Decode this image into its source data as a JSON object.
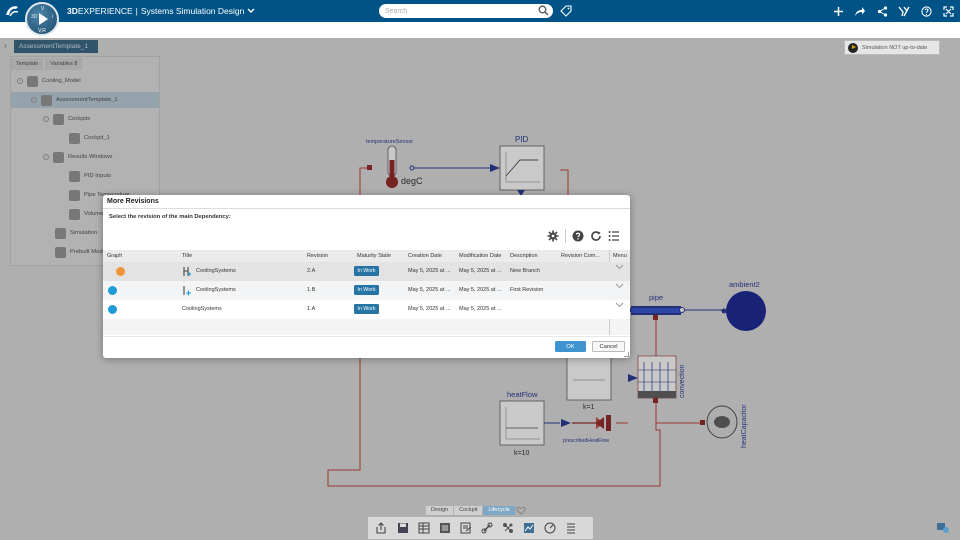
{
  "app": {
    "brand_bold": "3D",
    "brand_name": "EXPERIENCE",
    "separator": "|",
    "app_title": "Systems Simulation Design",
    "compass_version": "V,R",
    "compass_labels": [
      "3D",
      "V",
      "i"
    ],
    "search_placeholder": "Search"
  },
  "tree": {
    "tab_label": "AssessmentTemplate_1",
    "subtabs": [
      "Template",
      "Variables 8"
    ],
    "nodes": [
      {
        "label": "Cooling_Model",
        "depth": 0
      },
      {
        "label": "AssessmentTemplate_1",
        "depth": 1
      },
      {
        "label": "Cockpits",
        "depth": 2
      },
      {
        "label": "Cockpit_1",
        "depth": 3
      },
      {
        "label": "Results Windows",
        "depth": 2
      },
      {
        "label": "PID Inputs",
        "depth": 3
      },
      {
        "label": "Pipe Temperature",
        "depth": 3
      },
      {
        "label": "Volume",
        "depth": 3
      },
      {
        "label": "Simulation",
        "depth": 2
      },
      {
        "label": "Prebuilt Models",
        "depth": 2
      }
    ]
  },
  "diagram": {
    "labels": {
      "temperature_sensor": "temperatureSensor",
      "deg_c": "degC",
      "pid": "PID",
      "pipe": "pipe",
      "ambient": "ambient2",
      "heat_flow": "heatFlow",
      "k10": "k=10",
      "k1": "k=1",
      "prescribed_heat_flow": "prescribedHeatFlow",
      "convection": "convection",
      "heat_capacitor": "heatCapacitor"
    }
  },
  "status": {
    "simulation": "Simulation NOT up-to-date"
  },
  "view_tabs": [
    "Design",
    "Cockpit",
    "Lifecycle"
  ],
  "dialog": {
    "title": "More Revisions",
    "subtitle": "Select the revision of the main Dependency:",
    "columns": [
      "Graph",
      "Title",
      "Revision",
      "Maturity State",
      "Creation Date",
      "Modification Date",
      "Description",
      "Revision Com...",
      "Menu"
    ],
    "rows": [
      {
        "title": "CoolingSystems",
        "revision": "2.A",
        "maturity": "In Work",
        "created": "May 5, 2025 at ...",
        "modified": "May 5, 2025 at ...",
        "description": "New Branch",
        "revision_comment": "",
        "node_color": "#f0923a",
        "icon": "branch-icon"
      },
      {
        "title": "CoolingSystems",
        "revision": "1.B",
        "maturity": "In Work",
        "created": "May 5, 2025 at ...",
        "modified": "May 5, 2025 at ...",
        "description": "First Revision",
        "revision_comment": "",
        "node_color": "#1e9ad6",
        "icon": "revision-icon"
      },
      {
        "title": "CoolingSystems",
        "revision": "1.A",
        "maturity": "In Work",
        "created": "May 5, 2025 at ...",
        "modified": "May 5, 2025 at ...",
        "description": "",
        "revision_comment": "",
        "node_color": "#1e9ad6",
        "icon": ""
      }
    ],
    "ok_label": "OK",
    "cancel_label": "Cancel"
  },
  "colors": {
    "topbar": "#005386",
    "accent": "#3f94d0",
    "badge": "#2674a6",
    "diagram_red": "#c0392b"
  }
}
